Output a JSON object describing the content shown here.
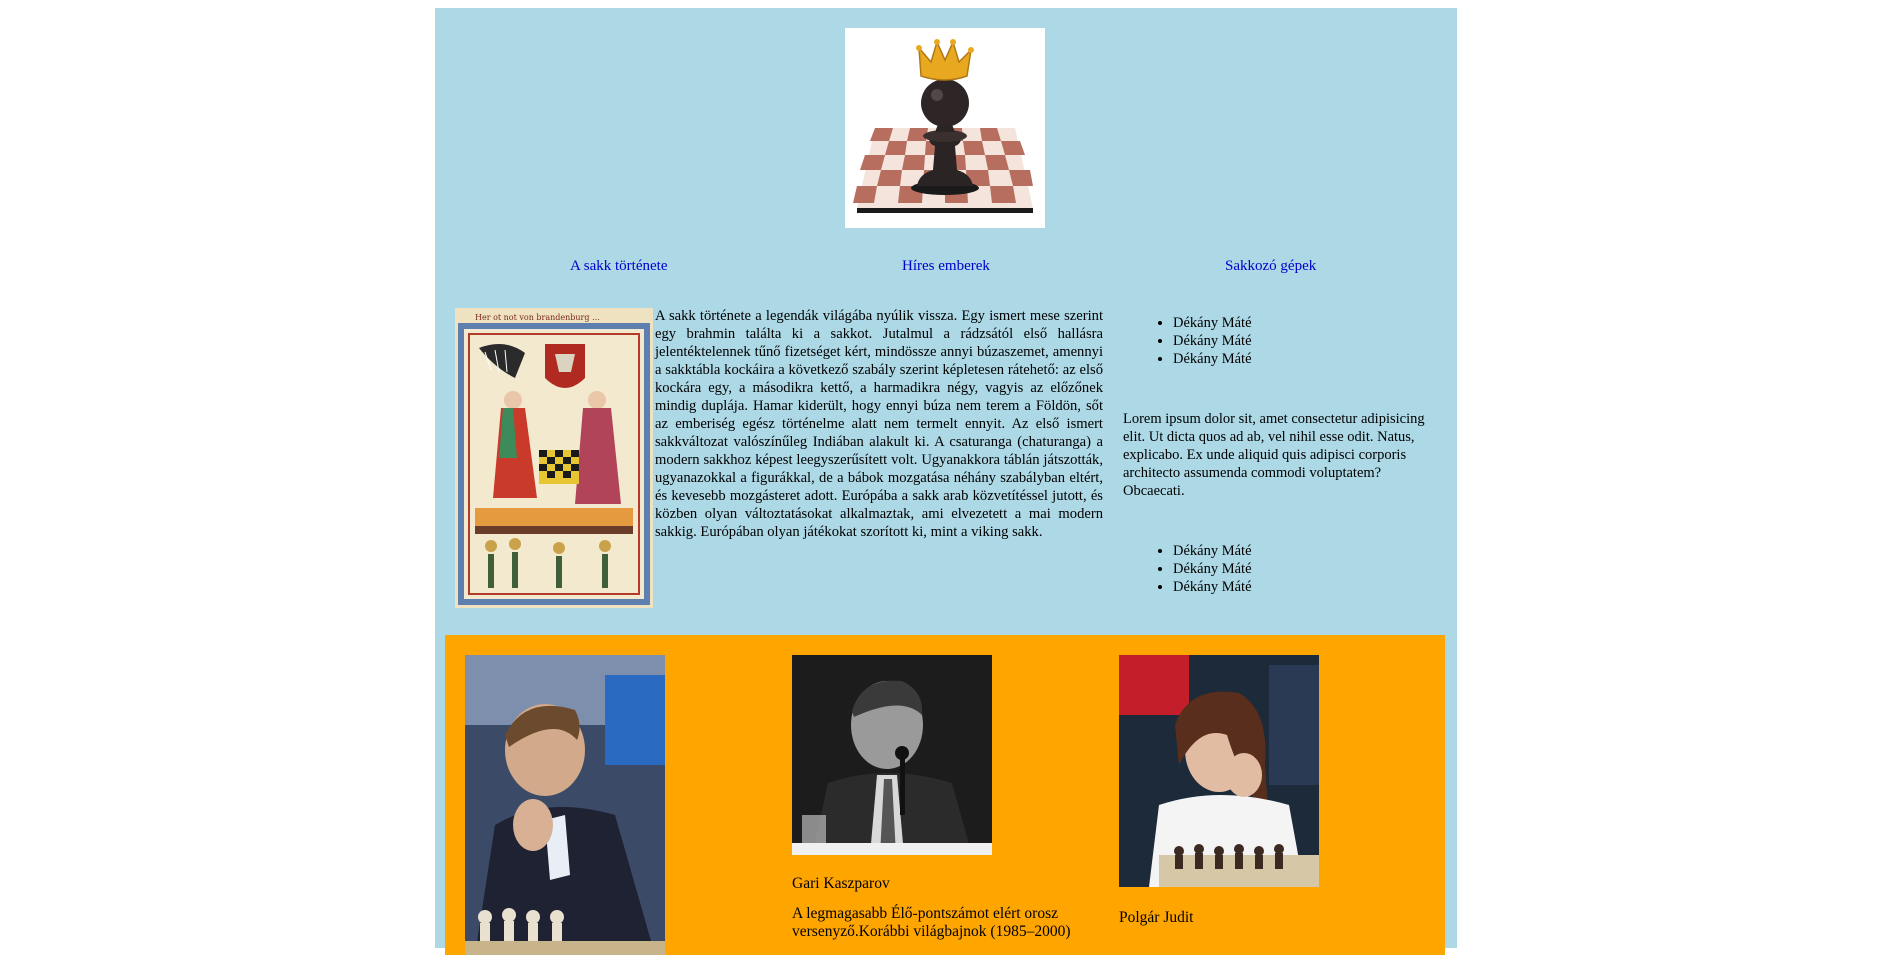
{
  "nav": {
    "items": [
      {
        "label": "A sakk története"
      },
      {
        "label": "Híres emberek"
      },
      {
        "label": "Sakkozó gépek"
      }
    ]
  },
  "history": {
    "text": "A sakk története a legendák világába nyúlik vissza. Egy ismert mese szerint egy brahmin találta ki a sakkot. Jutalmul a rádzsától első hallásra jelentéktelennek tűnő fizetséget kért, mindössze annyi búzaszemet, amennyi a sakktábla kockáira a következő szabály szerint képletesen rátehető: az első kockára egy, a másodikra kettő, a harmadikra négy, vagyis az előzőnek mindig duplája. Hamar kiderült, hogy ennyi búza nem terem a Földön, sőt az emberiség egész történelme alatt nem termelt ennyit. Az első ismert sakkváltozat valószínűleg Indiában alakult ki. A csaturanga (chaturanga) a modern sakkhoz képest leegyszerűsített volt. Ugyanakkora táblán játszották, ugyanazokkal a figurákkal, de a bábok mozgatása néhány szabályban eltért, és kevesebb mozgásteret adott. Európába a sakk arab közvetítéssel jutott, és közben olyan változtatásokat alkalmaztak, ami elvezetett a mai modern sakkig. Európában olyan játékokat szorított ki, mint a viking sakk."
  },
  "sidebar": {
    "list1": [
      "Dékány Máté",
      "Dékány Máté",
      "Dékány Máté"
    ],
    "lorem": "Lorem ipsum dolor sit, amet consectetur adipisicing elit. Ut dicta quos ad ab, vel nihil esse odit. Natus, explicabo. Ex unde aliquid quis adipisci corporis architecto assumenda commodi voluptatem? Obcaecati.",
    "list2": [
      "Dékány Máté",
      "Dékány Máté",
      "Dékány Máté"
    ]
  },
  "players": {
    "kasparov": {
      "name": "Gari Kaszparov",
      "desc": "A legmagasabb Élő-pontszámot elért orosz versenyző.Korábbi világbajnok (1985–2000)"
    },
    "polgar": {
      "name": "Polgár Judit"
    }
  },
  "colors": {
    "content_bg": "#add8e6",
    "players_bg": "#ffa500",
    "link": "#0000cc"
  }
}
